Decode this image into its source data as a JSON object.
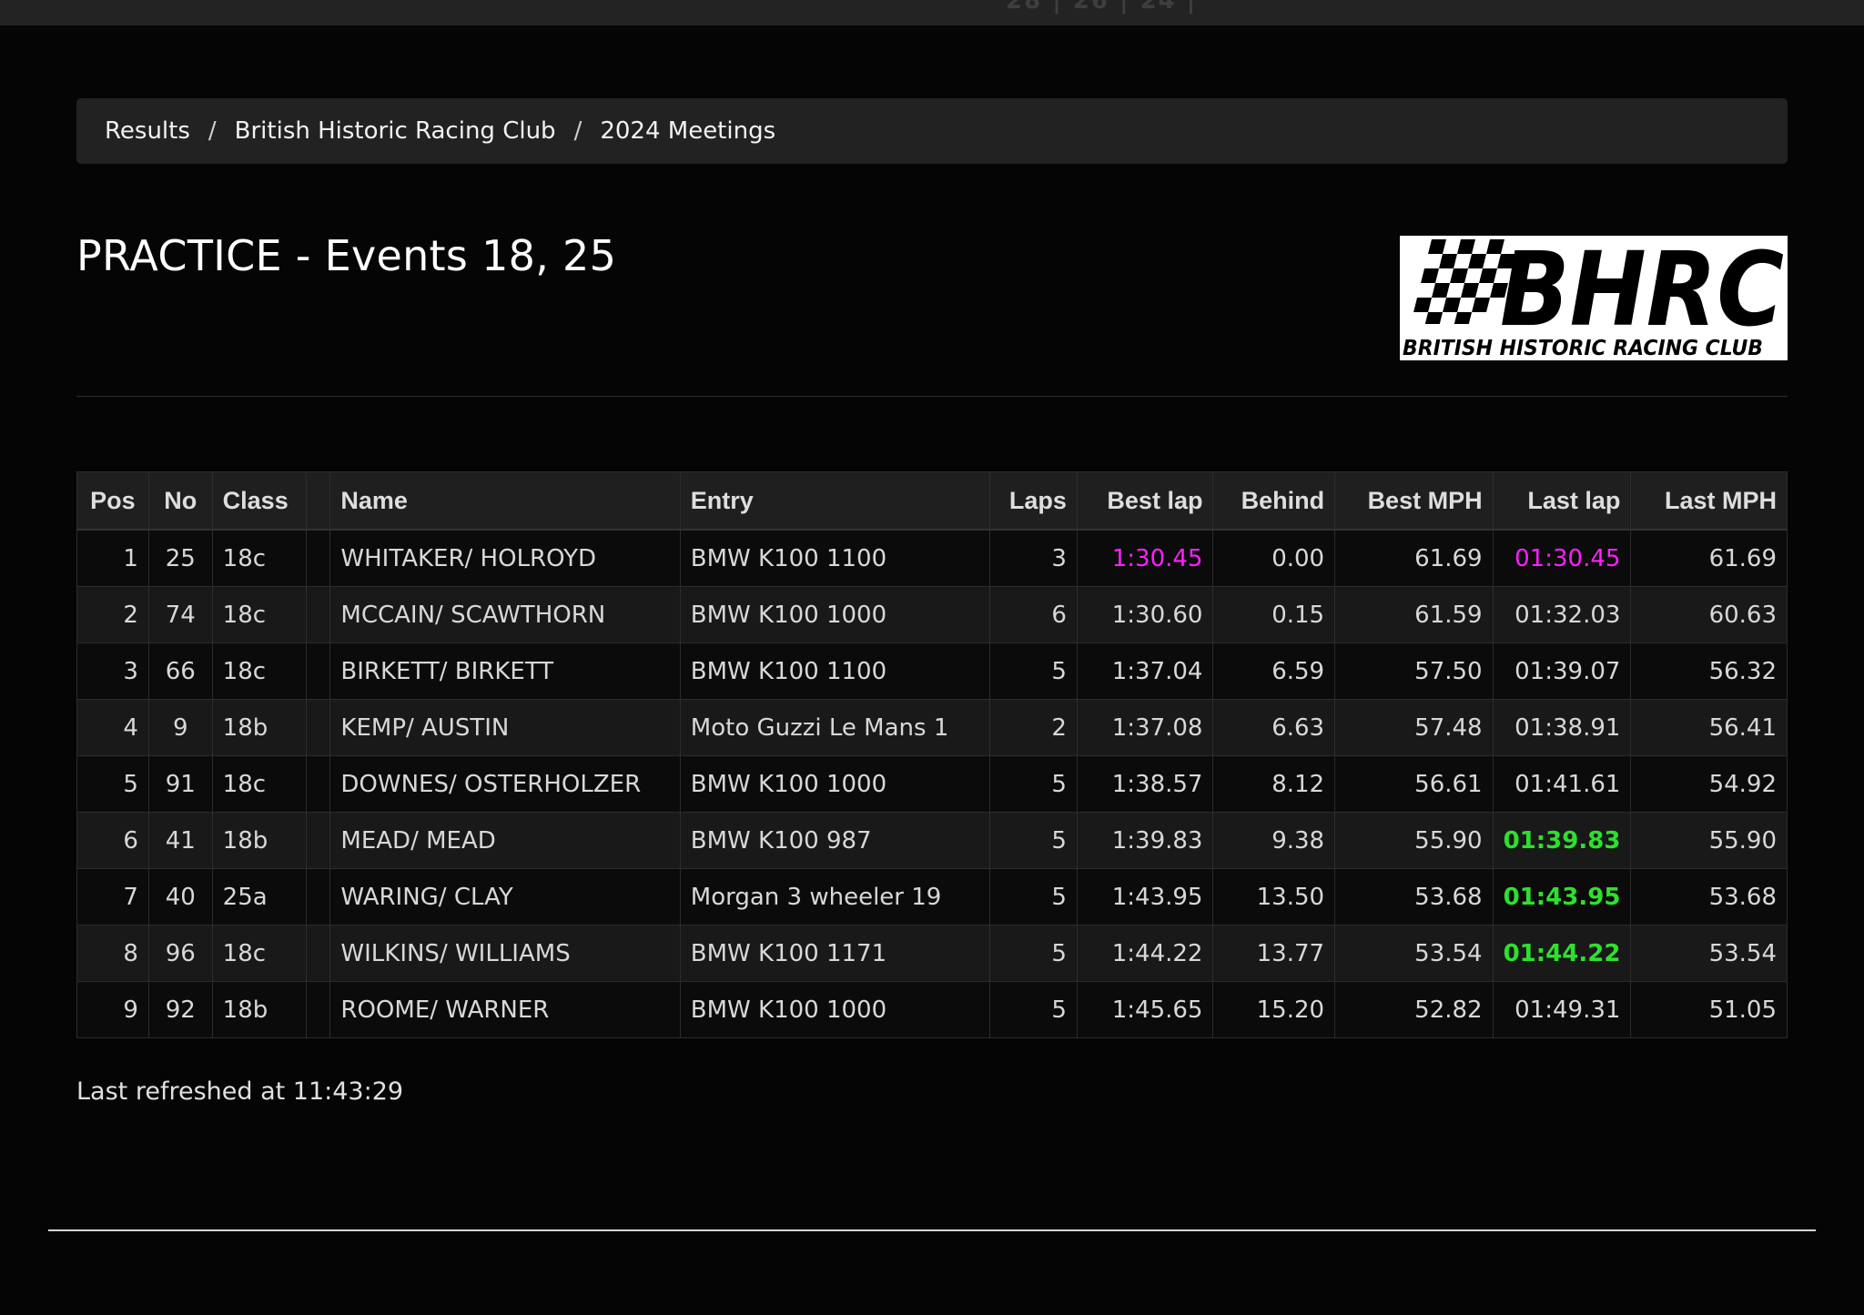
{
  "breadcrumb": {
    "items": [
      "Results",
      "British Historic Racing Club",
      "2024 Meetings"
    ],
    "separator": "/"
  },
  "title": "PRACTICE - Events 18, 25",
  "logo": {
    "main_text": "BHRC",
    "sub_text": "BRITISH HISTORIC RACING CLUB",
    "icon": "checkered-flag-icon"
  },
  "table": {
    "headers": {
      "pos": "Pos",
      "no": "No",
      "class": "Class",
      "blank": "",
      "name": "Name",
      "entry": "Entry",
      "laps": "Laps",
      "best_lap": "Best lap",
      "behind": "Behind",
      "best_mph": "Best MPH",
      "last_lap": "Last lap",
      "last_mph": "Last MPH"
    },
    "rows": [
      {
        "pos": "1",
        "no": "25",
        "class": "18c",
        "blank": "",
        "name": "WHITAKER/ HOLROYD",
        "entry": "BMW K100 1100",
        "laps": "3",
        "best_lap": "1:30.45",
        "behind": "0.00",
        "best_mph": "61.69",
        "last_lap": "01:30.45",
        "last_mph": "61.69"
      },
      {
        "pos": "2",
        "no": "74",
        "class": "18c",
        "blank": "",
        "name": "MCCAIN/ SCAWTHORN",
        "entry": "BMW K100 1000",
        "laps": "6",
        "best_lap": "1:30.60",
        "behind": "0.15",
        "best_mph": "61.59",
        "last_lap": "01:32.03",
        "last_mph": "60.63"
      },
      {
        "pos": "3",
        "no": "66",
        "class": "18c",
        "blank": "",
        "name": "BIRKETT/ BIRKETT",
        "entry": "BMW K100 1100",
        "laps": "5",
        "best_lap": "1:37.04",
        "behind": "6.59",
        "best_mph": "57.50",
        "last_lap": "01:39.07",
        "last_mph": "56.32"
      },
      {
        "pos": "4",
        "no": "9",
        "class": "18b",
        "blank": "",
        "name": "KEMP/ AUSTIN",
        "entry": "Moto Guzzi Le Mans 1",
        "laps": "2",
        "best_lap": "1:37.08",
        "behind": "6.63",
        "best_mph": "57.48",
        "last_lap": "01:38.91",
        "last_mph": "56.41"
      },
      {
        "pos": "5",
        "no": "91",
        "class": "18c",
        "blank": "",
        "name": "DOWNES/ OSTERHOLZER",
        "entry": "BMW K100 1000",
        "laps": "5",
        "best_lap": "1:38.57",
        "behind": "8.12",
        "best_mph": "56.61",
        "last_lap": "01:41.61",
        "last_mph": "54.92"
      },
      {
        "pos": "6",
        "no": "41",
        "class": "18b",
        "blank": "",
        "name": "MEAD/ MEAD",
        "entry": "BMW K100 987",
        "laps": "5",
        "best_lap": "1:39.83",
        "behind": "9.38",
        "best_mph": "55.90",
        "last_lap": "01:39.83",
        "last_mph": "55.90"
      },
      {
        "pos": "7",
        "no": "40",
        "class": "25a",
        "blank": "",
        "name": "WARING/ CLAY",
        "entry": "Morgan 3 wheeler 19",
        "laps": "5",
        "best_lap": "1:43.95",
        "behind": "13.50",
        "best_mph": "53.68",
        "last_lap": "01:43.95",
        "last_mph": "53.68"
      },
      {
        "pos": "8",
        "no": "96",
        "class": "18c",
        "blank": "",
        "name": "WILKINS/ WILLIAMS",
        "entry": "BMW K100 1171",
        "laps": "5",
        "best_lap": "1:44.22",
        "behind": "13.77",
        "best_mph": "53.54",
        "last_lap": "01:44.22",
        "last_mph": "53.54"
      },
      {
        "pos": "9",
        "no": "92",
        "class": "18b",
        "blank": "",
        "name": "ROOME/ WARNER",
        "entry": "BMW K100 1000",
        "laps": "5",
        "best_lap": "1:45.65",
        "behind": "15.20",
        "best_mph": "52.82",
        "last_lap": "01:49.31",
        "last_mph": "51.05"
      }
    ],
    "highlights": {
      "overall_best_row": 0,
      "personal_best_last_lap_rows": [
        5,
        6,
        7
      ]
    }
  },
  "colors": {
    "overall_best": "#ff1fff",
    "personal_best": "#2ee02e",
    "background": "#050505",
    "breadcrumb_bg": "#222222"
  },
  "last_refreshed": "Last refreshed at 11:43:29"
}
